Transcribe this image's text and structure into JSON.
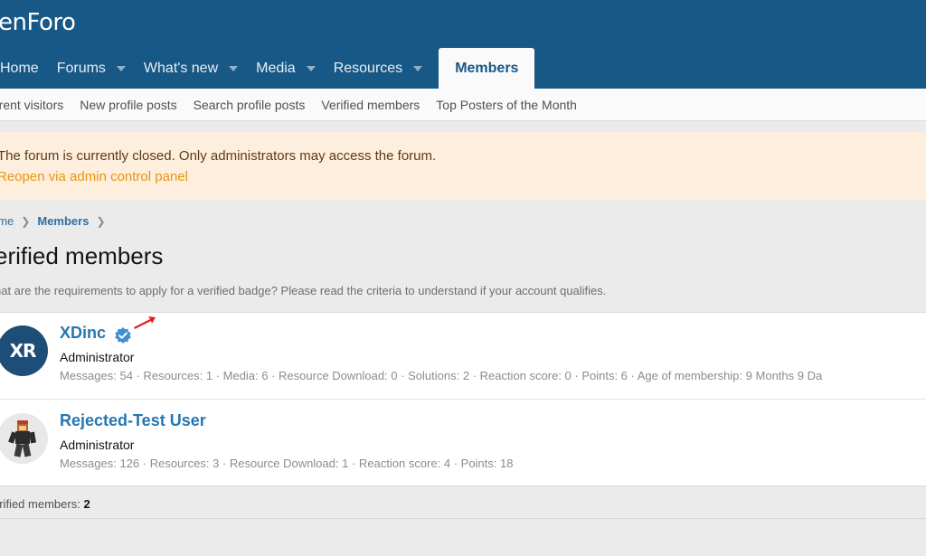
{
  "header": {
    "logo": "enForo",
    "tabs": [
      {
        "label": "Home",
        "dropdown": false
      },
      {
        "label": "Forums",
        "dropdown": true
      },
      {
        "label": "What's new",
        "dropdown": true
      },
      {
        "label": "Media",
        "dropdown": true
      },
      {
        "label": "Resources",
        "dropdown": true
      },
      {
        "label": "Members",
        "dropdown": false,
        "active": true
      }
    ]
  },
  "subnav": {
    "items": [
      "rrent visitors",
      "New profile posts",
      "Search profile posts",
      "Verified members",
      "Top Posters of the Month"
    ]
  },
  "notice": {
    "text": "The forum is currently closed. Only administrators may access the forum.",
    "link": "Reopen via admin control panel"
  },
  "breadcrumb": {
    "home": "ome",
    "members": "Members"
  },
  "page": {
    "title": "erified members",
    "description": "hat are the requirements to apply for a verified badge? Please read the criteria to understand if your account qualifies."
  },
  "members": [
    {
      "name": "XDinc",
      "avatar_text": "XR",
      "role": "Administrator",
      "stats": "Messages: 54 · Resources: 1 · Media: 6 · Resource Download: 0 · Solutions: 2 · Reaction score: 0 · Points: 6 · Age of membership: 9 Months 9 Da",
      "verified": true
    },
    {
      "name": "Rejected-Test User",
      "role": "Administrator",
      "stats": "Messages: 126 · Resources: 3 · Resource Download: 1 · Reaction score: 4 · Points: 18",
      "verified": false
    }
  ],
  "footer": {
    "label": "erified members:",
    "count": "2"
  },
  "colors": {
    "header_bg": "#185886",
    "accent": "#2577b1",
    "notice_bg": "#fdeedd",
    "notice_link": "#e8960f"
  }
}
